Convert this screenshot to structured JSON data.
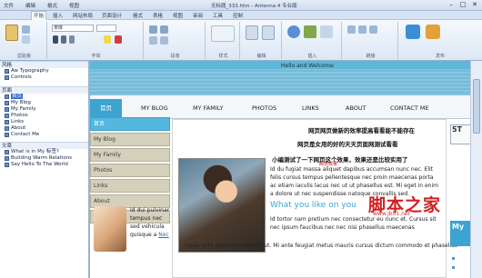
{
  "window": {
    "menu": [
      "文件",
      "编辑",
      "格式",
      "视图",
      "插入",
      "修改",
      "窗口",
      "帮助"
    ],
    "doc_title": "无标题_333.htm - Antenna 4 专业版",
    "controls": [
      "–",
      "□",
      "✕"
    ]
  },
  "ribbon_tabs": [
    "开始",
    "插入",
    "网站布局",
    "页面设计",
    "格式",
    "表格",
    "视图",
    "审阅",
    "工具",
    "控制"
  ],
  "ribbon": {
    "font_name": "宋体",
    "groups": [
      "剪贴板",
      "字体",
      "段落",
      "样式",
      "编辑",
      "插入",
      "链接",
      "发布"
    ]
  },
  "left_panel": {
    "section_styles": "风格",
    "styles": [
      "Aw Typography",
      "Controls"
    ],
    "section_pages": "页面",
    "pages": [
      "首页",
      "My Blog",
      "My Family",
      "Photos",
      "Links",
      "About",
      "Contact Me"
    ],
    "section_articles": "文章",
    "articles": [
      "What is in My 标签?",
      "Building Warm Relations",
      "Say Hello To The World"
    ]
  },
  "site": {
    "welcome": "Hello and Welcome",
    "nav": [
      "首页",
      "MY BLOG",
      "MY FAMILY",
      "PHOTOS",
      "LINKS",
      "ABOUT",
      "CONTACT ME"
    ],
    "side_nav": [
      "首页",
      "My Blog",
      "My Family",
      "Photos",
      "Links",
      "About",
      "Contact Me"
    ],
    "side_text": "Id dui pulvinar tempus nec sed vehicula quisque a",
    "side_link": "Nec",
    "cn_lines": [
      "网页网页做新的效率提高看看能不能存在",
      "网页是女用的好的天天页面网测试看看",
      "小编测试了一下网页这个效果，效果还是比较实用了"
    ],
    "cn_red_fragment": "网页效果",
    "lorem1": "Id du fugiat massa aliquet dapibus accumsan nunc nec. Elit felis cursus tempus pellentesque nec proin maecenas porta ac etiam iaculis lacus nec ut ut phasellus est. Mi eget in enim a dolore ut nec suspendisse natoque convallis sed.",
    "heading": "What you like on you",
    "lorem2": "Id tortor nam pretium nec consectetur eu nunc et. Cursus sit nec ipsum faucibus nec nec nisi phasellus maecenas",
    "bottom_line": "ligula ante posuere molestie ut. Mi ante feugiat metus mauris cursus dictum commodo et phasellus",
    "right_card": "5T",
    "right_card2": "My"
  },
  "watermark": "脚本之家",
  "watermark_url": "www.jb51.net",
  "colors": {
    "accent": "#3da3d0",
    "side_nav_bg": "#d5d0bc",
    "header_bg": "#5fb7d8"
  }
}
